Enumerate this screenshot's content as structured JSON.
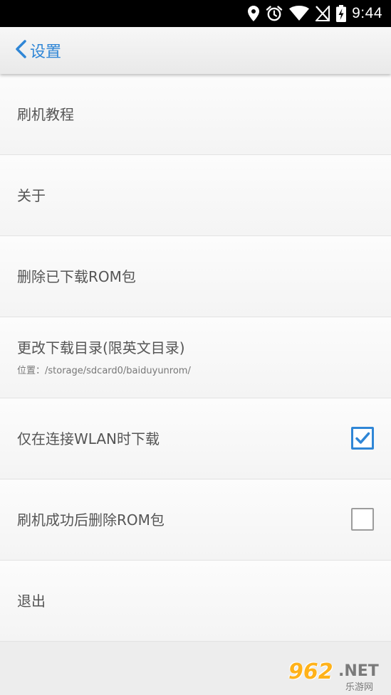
{
  "status_bar": {
    "icons": [
      "location-icon",
      "alarm-icon",
      "wifi-icon",
      "no-sim-icon",
      "battery-charging-icon"
    ],
    "time": "9:44"
  },
  "app_bar": {
    "title": "设置",
    "accent_color": "#2f86d6"
  },
  "settings": {
    "items": [
      {
        "label": "刷机教程"
      },
      {
        "label": "关于"
      },
      {
        "label": "删除已下载ROM包"
      },
      {
        "label": "更改下载目录(限英文目录)",
        "sub": "位置：/storage/sdcard0/baiduyunrom/"
      },
      {
        "label": "仅在连接WLAN时下载",
        "checked": true
      },
      {
        "label": "刷机成功后删除ROM包",
        "checked": false
      },
      {
        "label": "退出"
      }
    ]
  },
  "watermark": {
    "number": "962",
    "suffix": ".NET",
    "cn": "乐游网"
  }
}
